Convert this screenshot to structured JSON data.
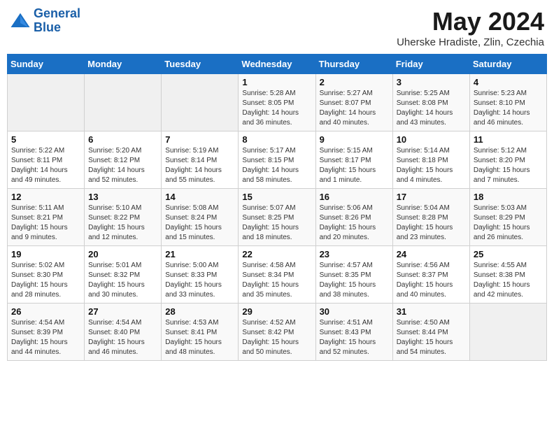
{
  "header": {
    "logo": {
      "line1": "General",
      "line2": "Blue"
    },
    "title": "May 2024",
    "location": "Uherske Hradiste, Zlin, Czechia"
  },
  "weekdays": [
    "Sunday",
    "Monday",
    "Tuesday",
    "Wednesday",
    "Thursday",
    "Friday",
    "Saturday"
  ],
  "weeks": [
    [
      {
        "day": "",
        "info": ""
      },
      {
        "day": "",
        "info": ""
      },
      {
        "day": "",
        "info": ""
      },
      {
        "day": "1",
        "info": "Sunrise: 5:28 AM\nSunset: 8:05 PM\nDaylight: 14 hours\nand 36 minutes."
      },
      {
        "day": "2",
        "info": "Sunrise: 5:27 AM\nSunset: 8:07 PM\nDaylight: 14 hours\nand 40 minutes."
      },
      {
        "day": "3",
        "info": "Sunrise: 5:25 AM\nSunset: 8:08 PM\nDaylight: 14 hours\nand 43 minutes."
      },
      {
        "day": "4",
        "info": "Sunrise: 5:23 AM\nSunset: 8:10 PM\nDaylight: 14 hours\nand 46 minutes."
      }
    ],
    [
      {
        "day": "5",
        "info": "Sunrise: 5:22 AM\nSunset: 8:11 PM\nDaylight: 14 hours\nand 49 minutes."
      },
      {
        "day": "6",
        "info": "Sunrise: 5:20 AM\nSunset: 8:12 PM\nDaylight: 14 hours\nand 52 minutes."
      },
      {
        "day": "7",
        "info": "Sunrise: 5:19 AM\nSunset: 8:14 PM\nDaylight: 14 hours\nand 55 minutes."
      },
      {
        "day": "8",
        "info": "Sunrise: 5:17 AM\nSunset: 8:15 PM\nDaylight: 14 hours\nand 58 minutes."
      },
      {
        "day": "9",
        "info": "Sunrise: 5:15 AM\nSunset: 8:17 PM\nDaylight: 15 hours\nand 1 minute."
      },
      {
        "day": "10",
        "info": "Sunrise: 5:14 AM\nSunset: 8:18 PM\nDaylight: 15 hours\nand 4 minutes."
      },
      {
        "day": "11",
        "info": "Sunrise: 5:12 AM\nSunset: 8:20 PM\nDaylight: 15 hours\nand 7 minutes."
      }
    ],
    [
      {
        "day": "12",
        "info": "Sunrise: 5:11 AM\nSunset: 8:21 PM\nDaylight: 15 hours\nand 9 minutes."
      },
      {
        "day": "13",
        "info": "Sunrise: 5:10 AM\nSunset: 8:22 PM\nDaylight: 15 hours\nand 12 minutes."
      },
      {
        "day": "14",
        "info": "Sunrise: 5:08 AM\nSunset: 8:24 PM\nDaylight: 15 hours\nand 15 minutes."
      },
      {
        "day": "15",
        "info": "Sunrise: 5:07 AM\nSunset: 8:25 PM\nDaylight: 15 hours\nand 18 minutes."
      },
      {
        "day": "16",
        "info": "Sunrise: 5:06 AM\nSunset: 8:26 PM\nDaylight: 15 hours\nand 20 minutes."
      },
      {
        "day": "17",
        "info": "Sunrise: 5:04 AM\nSunset: 8:28 PM\nDaylight: 15 hours\nand 23 minutes."
      },
      {
        "day": "18",
        "info": "Sunrise: 5:03 AM\nSunset: 8:29 PM\nDaylight: 15 hours\nand 26 minutes."
      }
    ],
    [
      {
        "day": "19",
        "info": "Sunrise: 5:02 AM\nSunset: 8:30 PM\nDaylight: 15 hours\nand 28 minutes."
      },
      {
        "day": "20",
        "info": "Sunrise: 5:01 AM\nSunset: 8:32 PM\nDaylight: 15 hours\nand 30 minutes."
      },
      {
        "day": "21",
        "info": "Sunrise: 5:00 AM\nSunset: 8:33 PM\nDaylight: 15 hours\nand 33 minutes."
      },
      {
        "day": "22",
        "info": "Sunrise: 4:58 AM\nSunset: 8:34 PM\nDaylight: 15 hours\nand 35 minutes."
      },
      {
        "day": "23",
        "info": "Sunrise: 4:57 AM\nSunset: 8:35 PM\nDaylight: 15 hours\nand 38 minutes."
      },
      {
        "day": "24",
        "info": "Sunrise: 4:56 AM\nSunset: 8:37 PM\nDaylight: 15 hours\nand 40 minutes."
      },
      {
        "day": "25",
        "info": "Sunrise: 4:55 AM\nSunset: 8:38 PM\nDaylight: 15 hours\nand 42 minutes."
      }
    ],
    [
      {
        "day": "26",
        "info": "Sunrise: 4:54 AM\nSunset: 8:39 PM\nDaylight: 15 hours\nand 44 minutes."
      },
      {
        "day": "27",
        "info": "Sunrise: 4:54 AM\nSunset: 8:40 PM\nDaylight: 15 hours\nand 46 minutes."
      },
      {
        "day": "28",
        "info": "Sunrise: 4:53 AM\nSunset: 8:41 PM\nDaylight: 15 hours\nand 48 minutes."
      },
      {
        "day": "29",
        "info": "Sunrise: 4:52 AM\nSunset: 8:42 PM\nDaylight: 15 hours\nand 50 minutes."
      },
      {
        "day": "30",
        "info": "Sunrise: 4:51 AM\nSunset: 8:43 PM\nDaylight: 15 hours\nand 52 minutes."
      },
      {
        "day": "31",
        "info": "Sunrise: 4:50 AM\nSunset: 8:44 PM\nDaylight: 15 hours\nand 54 minutes."
      },
      {
        "day": "",
        "info": ""
      }
    ]
  ]
}
